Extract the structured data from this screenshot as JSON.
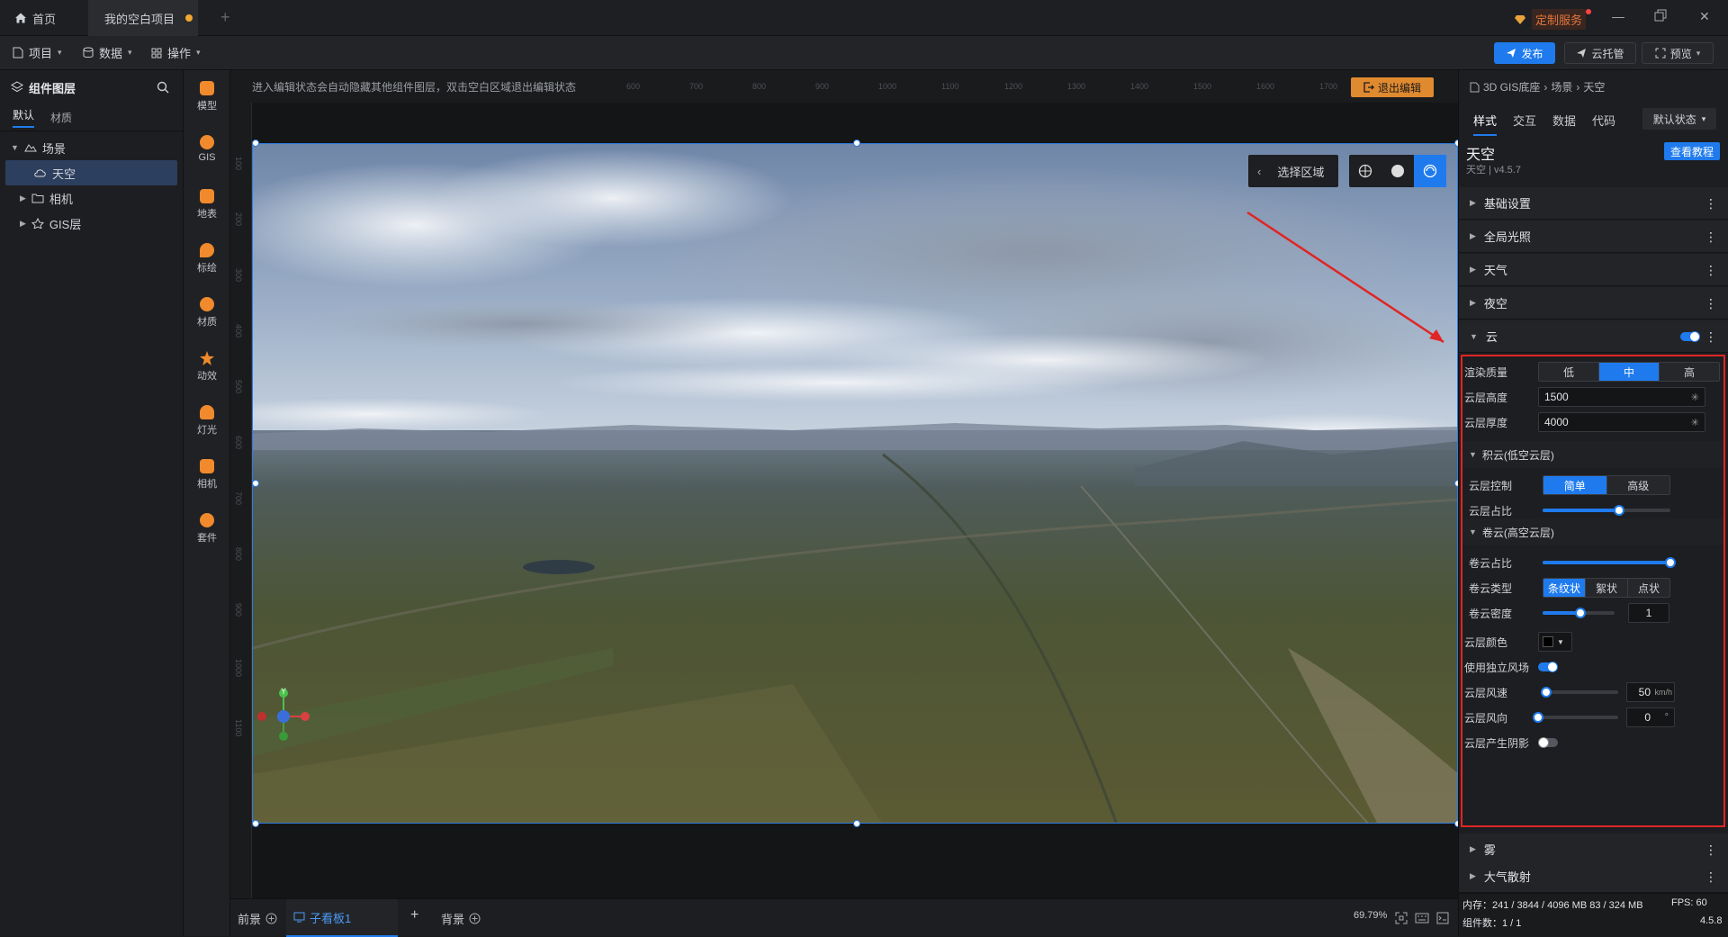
{
  "tabs": {
    "home": "首页",
    "project": "我的空白项目"
  },
  "custom_service": "定制服务",
  "menus": {
    "project": "项目",
    "data": "数据",
    "operate": "操作"
  },
  "actions": {
    "publish": "发布",
    "cloud_host": "云托管",
    "preview": "预览"
  },
  "left_panel": {
    "title": "组件图层",
    "tabs": [
      "默认",
      "材质"
    ],
    "tree": [
      {
        "label": "场景"
      },
      {
        "label": "天空"
      },
      {
        "label": "相机"
      },
      {
        "label": "GIS层"
      }
    ]
  },
  "side_tools": [
    "模型",
    "GIS",
    "地表",
    "标绘",
    "材质",
    "动效",
    "灯光",
    "相机",
    "套件"
  ],
  "canvas": {
    "hint": "进入编辑状态会自动隐藏其他组件图层，双击空白区域退出编辑状态",
    "exit_edit": "退出编辑",
    "select_area": "选择区域",
    "ruler_h": [
      "600",
      "700",
      "800",
      "900",
      "1000",
      "1100",
      "1200",
      "1300",
      "1400",
      "1500",
      "1600",
      "1700"
    ],
    "ruler_v": [
      "100",
      "200",
      "300",
      "400",
      "500",
      "600",
      "700",
      "800",
      "900",
      "1000",
      "1100"
    ],
    "gizmo_y": "Y"
  },
  "bottom": {
    "foreground": "前景",
    "subboard": "子看板1",
    "background": "背景",
    "zoom": "69.79%"
  },
  "right_panel": {
    "breadcrumb": [
      "3D GIS底座",
      "场景",
      "天空"
    ],
    "tabs": [
      "样式",
      "交互",
      "数据",
      "代码"
    ],
    "state": "默认状态",
    "component_name": "天空",
    "component_version": "天空 | v4.5.7",
    "tutorial": "查看教程",
    "sections_top": [
      "基础设置",
      "全局光照",
      "天气",
      "夜空"
    ],
    "cloud_section": "云",
    "cloud": {
      "render_quality": {
        "label": "渲染质量",
        "options": [
          "低",
          "中",
          "高"
        ],
        "selected": "中"
      },
      "cloud_height": {
        "label": "云层高度",
        "value": "1500"
      },
      "cloud_thickness": {
        "label": "云层厚度",
        "value": "4000"
      },
      "cumulus_title": "积云(低空云层)",
      "cloud_control": {
        "label": "云层控制",
        "options": [
          "简单",
          "高级"
        ],
        "selected": "简单"
      },
      "cloud_ratio": {
        "label": "云层占比",
        "value": 0.6
      },
      "cirrus_title": "卷云(高空云层)",
      "cirrus_ratio": {
        "label": "卷云占比",
        "value": 1.0
      },
      "cirrus_type": {
        "label": "卷云类型",
        "options": [
          "条纹状",
          "絮状",
          "点状"
        ],
        "selected": "条纹状"
      },
      "cirrus_density": {
        "label": "卷云密度",
        "value": "1",
        "slider": 0.52
      },
      "cloud_color": {
        "label": "云层颜色",
        "color": "#000000"
      },
      "independent_wind": {
        "label": "使用独立风场",
        "on": true
      },
      "wind_speed": {
        "label": "云层风速",
        "value": "50",
        "unit": "km/h",
        "slider": 0.05
      },
      "wind_dir": {
        "label": "云层风向",
        "value": "0",
        "unit": "°",
        "slider": 0.0
      },
      "cloud_shadow": {
        "label": "云层产生阴影",
        "on": false
      }
    },
    "sections_bottom": [
      "雾",
      "大气散射"
    ],
    "status": {
      "memory": "内存：241 / 3844 / 4096 MB  83 / 324 MB",
      "fps": "FPS:  60",
      "components": "组件数：1 / 1",
      "version": "4.5.8"
    }
  },
  "colors": {
    "accent": "#1f7bed",
    "highlight_box": "#e02525",
    "exit_btn": "#e08a30"
  }
}
